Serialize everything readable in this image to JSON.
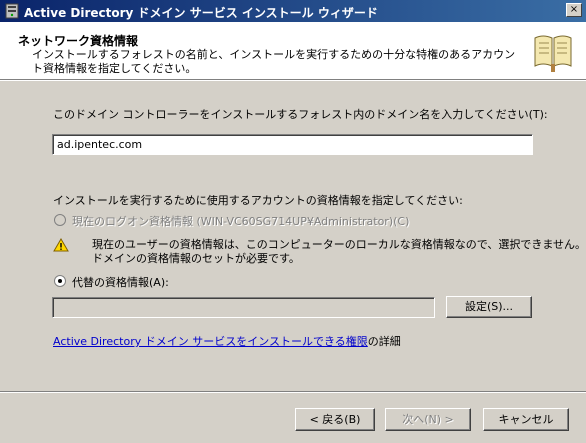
{
  "window": {
    "title": "Active Directory ドメイン サービス インストール ウィザード",
    "close_glyph": "×"
  },
  "header": {
    "title": "ネットワーク資格情報",
    "description": "インストールするフォレストの名前と、インストールを実行するための十分な特権のあるアカウント資格情報を指定してください。"
  },
  "domain_prompt": "このドメイン コントローラーをインストールするフォレスト内のドメイン名を入力してください(T):",
  "domain_value": "ad.ipentec.com",
  "credentials_prompt": "インストールを実行するために使用するアカウントの資格情報を指定してください:",
  "radio_current": {
    "label": "現在のログオン資格情報 (WIN-VC60SG714UP¥Administrator)(C)",
    "selected": false,
    "enabled": false
  },
  "warning": {
    "icon": "warning-icon",
    "text_line1": "現在のユーザーの資格情報は、このコンピューターのローカルな資格情報なので、選択できません。",
    "text_line2": "ドメインの資格情報のセットが必要です。"
  },
  "radio_alternate": {
    "label": "代替の資格情報(A):",
    "selected": true,
    "enabled": true
  },
  "alternate_value": "",
  "set_button": "設定(S)...",
  "link_text": "Active Directory ドメイン サービスをインストールできる権限",
  "link_suffix": "の詳細",
  "buttons": {
    "back": "< 戻る(B)",
    "next": "次へ(N) >",
    "cancel": "キャンセル"
  },
  "colors": {
    "titlebar_start": "#0a246a",
    "titlebar_end": "#3a6ea5",
    "face": "#d4d0c8",
    "link": "#0000cc"
  }
}
